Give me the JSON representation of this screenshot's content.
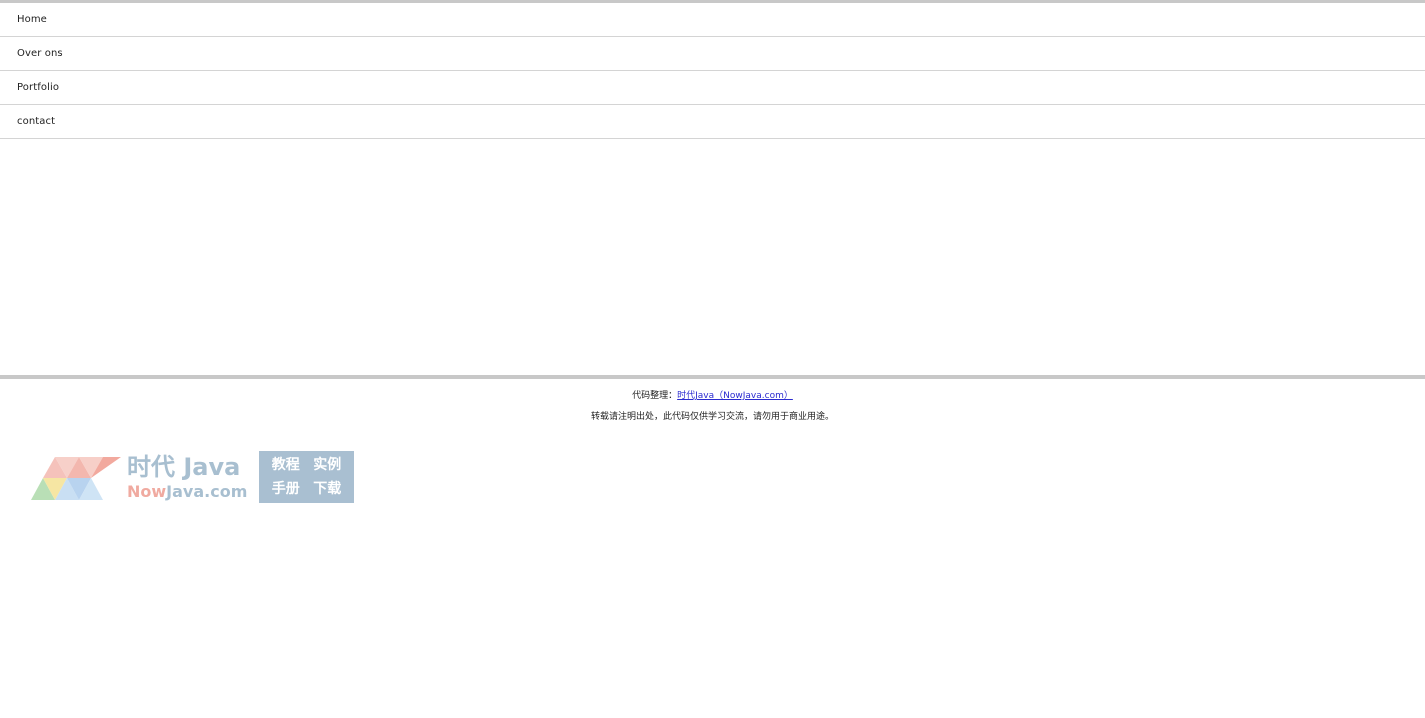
{
  "nav": {
    "items": [
      {
        "label": "Home"
      },
      {
        "label": "Over ons"
      },
      {
        "label": "Portfolio"
      },
      {
        "label": "contact"
      }
    ]
  },
  "footer": {
    "credit_prefix": "代码整理：",
    "credit_link": "时代Java（NowJava.com）",
    "notice": "转载请注明出处，此代码仅供学习交流，请勿用于商业用途。"
  },
  "logo": {
    "title_cn": "时代 Java",
    "domain_now": "Now",
    "domain_rest": "Java.com",
    "box": [
      "教程",
      "实例",
      "手册",
      "下载"
    ]
  },
  "colors": {
    "rule": "#c8c8c8",
    "link": "#2b2bd0",
    "logo_blue": "#a8bfd0",
    "logo_pink": "#f0aaa0"
  }
}
